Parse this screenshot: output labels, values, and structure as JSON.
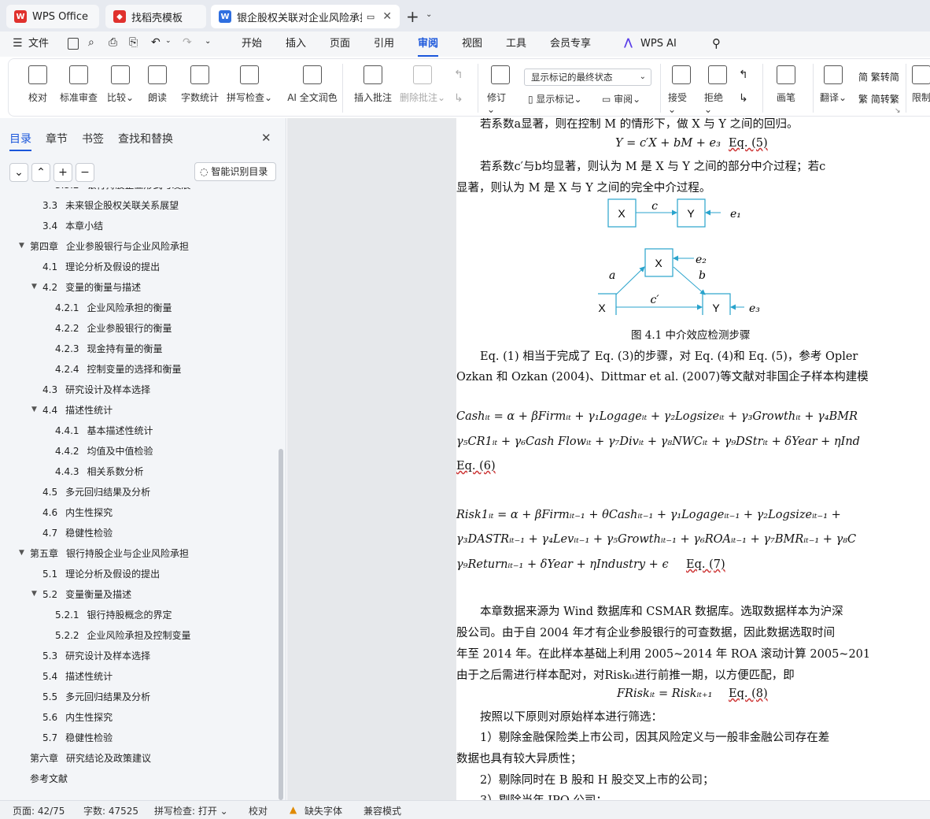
{
  "tabs": {
    "wps": "WPS Office",
    "template": "找稻壳模板",
    "doc": "银企股权关联对企业风险承担"
  },
  "menu": {
    "file": "文件",
    "items": [
      "开始",
      "插入",
      "页面",
      "引用",
      "审阅",
      "视图",
      "工具",
      "会员专享",
      "WPS AI"
    ],
    "active": "审阅"
  },
  "ribbon": {
    "group1": [
      "校对",
      "标准审查",
      "比较",
      "朗读",
      "字数统计",
      "拼写检查",
      "AI 全文润色"
    ],
    "insert_comment": "插入批注",
    "delete_comment": "删除批注",
    "revise": "修订",
    "markup_select": "显示标记的最终状态",
    "show_markup": "显示标记",
    "review": "审阅",
    "accept": "接受",
    "reject": "拒绝",
    "pen": "画笔",
    "translate": "翻译",
    "to_simp": "繁转简",
    "to_trad": "简转繁",
    "restrict": "限制"
  },
  "sidebar": {
    "tabs": [
      "目录",
      "章节",
      "书签",
      "查找和替换"
    ],
    "active_tab": "目录",
    "smart_button": "智能识别目录",
    "toc": [
      {
        "num": "3.3.2",
        "text": "银行持股企业形式与发展",
        "level": 3
      },
      {
        "num": "3.3",
        "text": "未来银企股权关联关系展望",
        "level": 2
      },
      {
        "num": "3.4",
        "text": "本章小结",
        "level": 2
      },
      {
        "num": "第四章",
        "text": "企业参股银行与企业风险承担",
        "level": 1,
        "exp": true
      },
      {
        "num": "4.1",
        "text": "理论分析及假设的提出",
        "level": 2
      },
      {
        "num": "4.2",
        "text": "变量的衡量与描述",
        "level": 2,
        "exp": true
      },
      {
        "num": "4.2.1",
        "text": "企业风险承担的衡量",
        "level": 3
      },
      {
        "num": "4.2.2",
        "text": "企业参股银行的衡量",
        "level": 3
      },
      {
        "num": "4.2.3",
        "text": "现金持有量的衡量",
        "level": 3
      },
      {
        "num": "4.2.4",
        "text": "控制变量的选择和衡量",
        "level": 3
      },
      {
        "num": "4.3",
        "text": "研究设计及样本选择",
        "level": 2
      },
      {
        "num": "4.4",
        "text": "描述性统计",
        "level": 2,
        "exp": true
      },
      {
        "num": "4.4.1",
        "text": "基本描述性统计",
        "level": 3
      },
      {
        "num": "4.4.2",
        "text": "均值及中值检验",
        "level": 3
      },
      {
        "num": "4.4.3",
        "text": "相关系数分析",
        "level": 3
      },
      {
        "num": "4.5",
        "text": "多元回归结果及分析",
        "level": 2
      },
      {
        "num": "4.6",
        "text": "内生性探究",
        "level": 2
      },
      {
        "num": "4.7",
        "text": "稳健性检验",
        "level": 2
      },
      {
        "num": "第五章",
        "text": "银行持股企业与企业风险承担",
        "level": 1,
        "exp": true
      },
      {
        "num": "5.1",
        "text": "理论分析及假设的提出",
        "level": 2
      },
      {
        "num": "5.2",
        "text": "变量衡量及描述",
        "level": 2,
        "exp": true
      },
      {
        "num": "5.2.1",
        "text": "银行持股概念的界定",
        "level": 3
      },
      {
        "num": "5.2.2",
        "text": "企业风险承担及控制变量",
        "level": 3
      },
      {
        "num": "5.3",
        "text": "研究设计及样本选择",
        "level": 2
      },
      {
        "num": "5.4",
        "text": "描述性统计",
        "level": 2
      },
      {
        "num": "5.5",
        "text": "多元回归结果及分析",
        "level": 2
      },
      {
        "num": "5.6",
        "text": "内生性探究",
        "level": 2
      },
      {
        "num": "5.7",
        "text": "稳健性检验",
        "level": 2
      },
      {
        "num": "第六章",
        "text": "研究结论及政策建议",
        "level": 1
      },
      {
        "num": "",
        "text": "参考文献",
        "level": 1
      }
    ]
  },
  "doc": {
    "l1": "若系数a显著，则在控制 M 的情形下，做 X 与 Y 之间的回归。",
    "eq5": "Y = c′X + bM + e₃",
    "eq5tag": "Eq. (5)",
    "l3": "若系数c′与b均显著，则认为 M 是 X 与 Y 之间的部分中介过程；若c",
    "l4": "显著，则认为 M 是 X 与 Y 之间的完全中介过程。",
    "fig": {
      "X": "X",
      "Y": "Y",
      "c": "c",
      "e1": "e₁",
      "e2": "e₂",
      "e3": "e₃",
      "a": "a",
      "b": "b",
      "cp": "c′"
    },
    "caption": "图 4.1  中介效应检测步骤",
    "p1": "Eq. (1) 相当于完成了 Eq. (3)的步骤，对 Eq. (4)和 Eq. (5)，参考 Opler",
    "p2": "Ozkan 和 Ozkan (2004)、Dittmar et al. (2007)等文献对非国企子样本构建模",
    "eq6a": "Cashᵢₜ = α + βFirmᵢₜ + γ₁Logageᵢₜ + γ₂Logsizeᵢₜ + γ₃Growthᵢₜ + γ₄BMR",
    "eq6b": "γ₅CR1ᵢₜ + γ₆Cash Flowᵢₜ + γ₇Divᵢₜ + γ₈NWCᵢₜ + γ₉DStrᵢₜ + δYear + ηInd",
    "eq6tag": "Eq. (6)",
    "eq7a": "Risk1ᵢₜ = α + βFirmᵢₜ₋₁ + θCashᵢₜ₋₁ + γ₁Logageᵢₜ₋₁ + γ₂Logsizeᵢₜ₋₁ +",
    "eq7b": "γ₃DASTRᵢₜ₋₁ + γ₄Levᵢₜ₋₁ + γ₅Growthᵢₜ₋₁ + γ₆ROAᵢₜ₋₁ + γ₇BMRᵢₜ₋₁ + γ₈C",
    "eq7c": "γ₉Returnᵢₜ₋₁ + δYear + ηIndustry + ϵ",
    "eq7tag": "Eq. (7)",
    "d1": "本章数据来源为 Wind 数据库和 CSMAR 数据库。选取数据样本为沪深",
    "d2": "股公司。由于自 2004 年才有企业参股银行的可查数据，因此数据选取时间",
    "d3": "年至 2014 年。在此样本基础上利用 2005~2014 年 ROA 滚动计算 2005~201",
    "d4": "由于之后需进行样本配对，对Riskᵢₜ进行前推一期，以方便匹配，即",
    "eq8": "FRiskᵢₜ = Riskᵢₜ₊₁",
    "eq8tag": "Eq. (8)",
    "r0": "按照以下原则对原始样本进行筛选：",
    "r1": "1）剔除金融保险类上市公司，因其风险定义与一般非金融公司存在差",
    "r1b": "数据也具有较大异质性；",
    "r2": "2）剔除同时在 B 股和 H 股交叉上市的公司；",
    "r3": "3）剔除当年 IPO 公司；"
  },
  "status": {
    "page": "页面: 42/75",
    "words": "字数: 47525",
    "spell": "拼写检查: 打开",
    "proof": "校对",
    "font": "缺失字体",
    "compat": "兼容模式"
  }
}
